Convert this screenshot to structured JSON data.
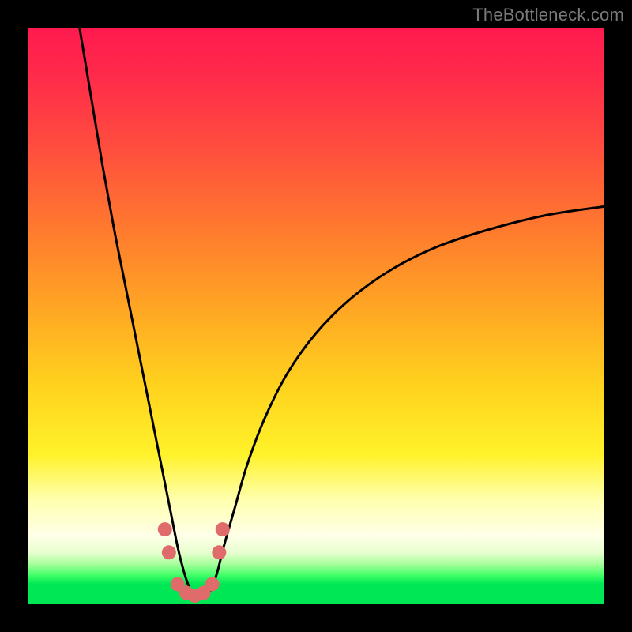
{
  "watermark": {
    "text": "TheBottleneck.com"
  },
  "chart_data": {
    "type": "line",
    "title": "",
    "xlabel": "",
    "ylabel": "",
    "xlim": [
      0,
      100
    ],
    "ylim": [
      0,
      100
    ],
    "grid": false,
    "legend": null,
    "series": [
      {
        "name": "bottleneck-curve",
        "color": "#000000",
        "x": [
          9,
          11,
          13,
          15,
          17,
          19,
          20,
          21,
          22,
          23,
          24,
          25,
          26,
          27,
          28,
          29,
          30,
          31,
          32,
          33,
          34,
          36,
          38,
          41,
          45,
          50,
          56,
          63,
          71,
          80,
          90,
          100
        ],
        "values": [
          100,
          88,
          76,
          65,
          55,
          45,
          40,
          35,
          30,
          25,
          20,
          15,
          10,
          6,
          3,
          1.5,
          1,
          1.5,
          3,
          6,
          10,
          17,
          24,
          32,
          40,
          47,
          53,
          58,
          62,
          65,
          67.5,
          69
        ]
      },
      {
        "name": "marker-dots",
        "type": "scatter",
        "color": "#e06b6b",
        "x": [
          23.8,
          24.5,
          26,
          27.5,
          29,
          30.5,
          32,
          33.2,
          33.8
        ],
        "values": [
          13,
          9,
          3.5,
          2,
          1.5,
          2,
          3.5,
          9,
          13
        ]
      }
    ],
    "annotations": []
  }
}
